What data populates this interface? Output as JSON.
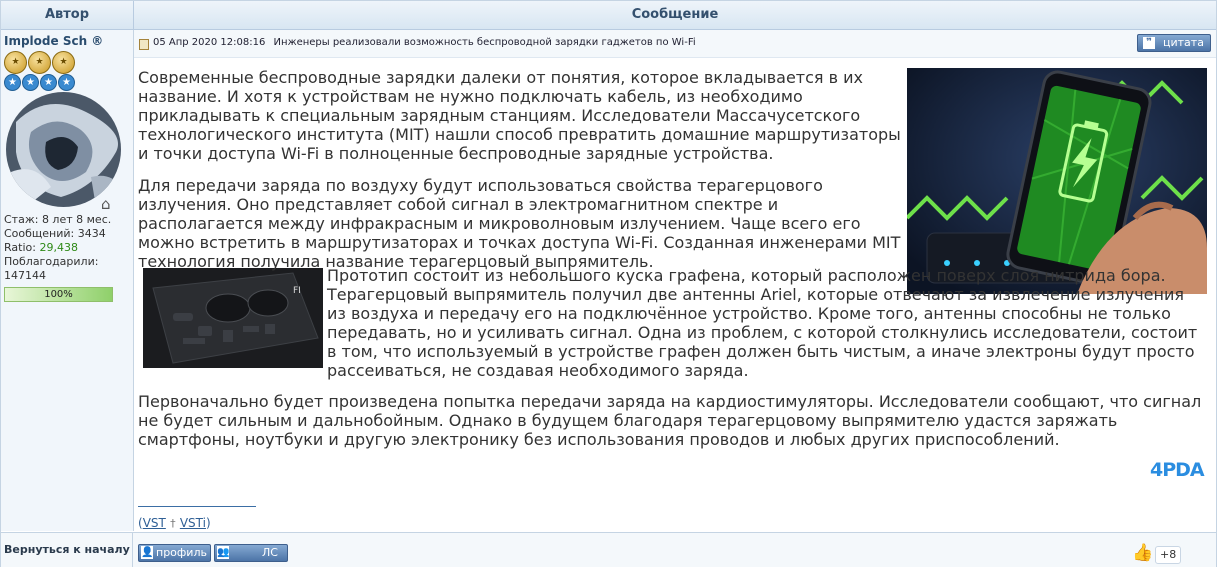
{
  "table": {
    "author_header": "Автор",
    "message_header": "Сообщение"
  },
  "user": {
    "name": "Implode Sch ®",
    "stazh": "Стаж: 8 лет 8 мес.",
    "posts_label": "Сообщений: 3434",
    "ratio_label": "Ratio:",
    "ratio_value": "29,438",
    "thanked_label": "Поблагодарили:",
    "thanked_value": "147144",
    "reputation": "100%",
    "reputation_fraction": 1.0
  },
  "post": {
    "date": "05 Апр 2020 12:08:16",
    "title": "Инженеры реализовали возможность беспроводной зарядки гаджетов по Wi-Fi",
    "quote_label": "цитата",
    "p1": "Современные беспроводные зарядки далеки от понятия, которое вкладывается в их название. И хотя к устройствам не нужно подключать кабель, из необходимо прикладывать к специальным зарядным станциям. Исследователи Массачусетского технологического института (MIT) нашли способ превратить домашние маршрутизаторы и точки доступа Wi-Fi в полноценные беспроводные зарядные устройства.",
    "p2": "Для передачи заряда по воздуху будут использоваться свойства терагерцового излучения. Оно представляет собой сигнал в электромагнитном спектре и располагается между инфракрасным и микроволновым излучением. Чаще всего его можно встретить в маршрутизаторах и точках доступа Wi-Fi. Созданная инженерами MIT технология получила название терагерцовый выпрямитель.",
    "p3": "Прототип состоит из небольшого куска графена, который расположен поверх слоя нитрида бора. Терагерцовый выпрямитель получил две антенны Ariel, которые отвечают за извлечение излучения из воздуха и передачу его на подключённое устройство. Кроме того, антенны способны не только передавать, но и усиливать сигнал. Одна из проблем, с которой столкнулись исследователи, состоит в том, что используемый в устройстве графен должен быть чистым, а иначе электроны будут просто рассеиваться, не создавая необходимого заряда.",
    "p4": "Первоначально будет произведена попытка передачи заряда на кардиостимуляторы. Исследователи сообщают, что сигнал не будет сильным и дальнобойным. Однако в будущем благодаря терагерцовому выпрямителю удастся заряжать смартфоны, ноутбуки и другую электронику без использования проводов и любых других приспособлений.",
    "source_logo": "4PDA",
    "sig_open": "(",
    "sig_link1": "VST",
    "sig_link2": "VSTi",
    "sig_close": ")"
  },
  "footer": {
    "back_to_top": "Вернуться к началу",
    "profile": "профиль",
    "pm": "ЛС",
    "likes": "+8"
  }
}
